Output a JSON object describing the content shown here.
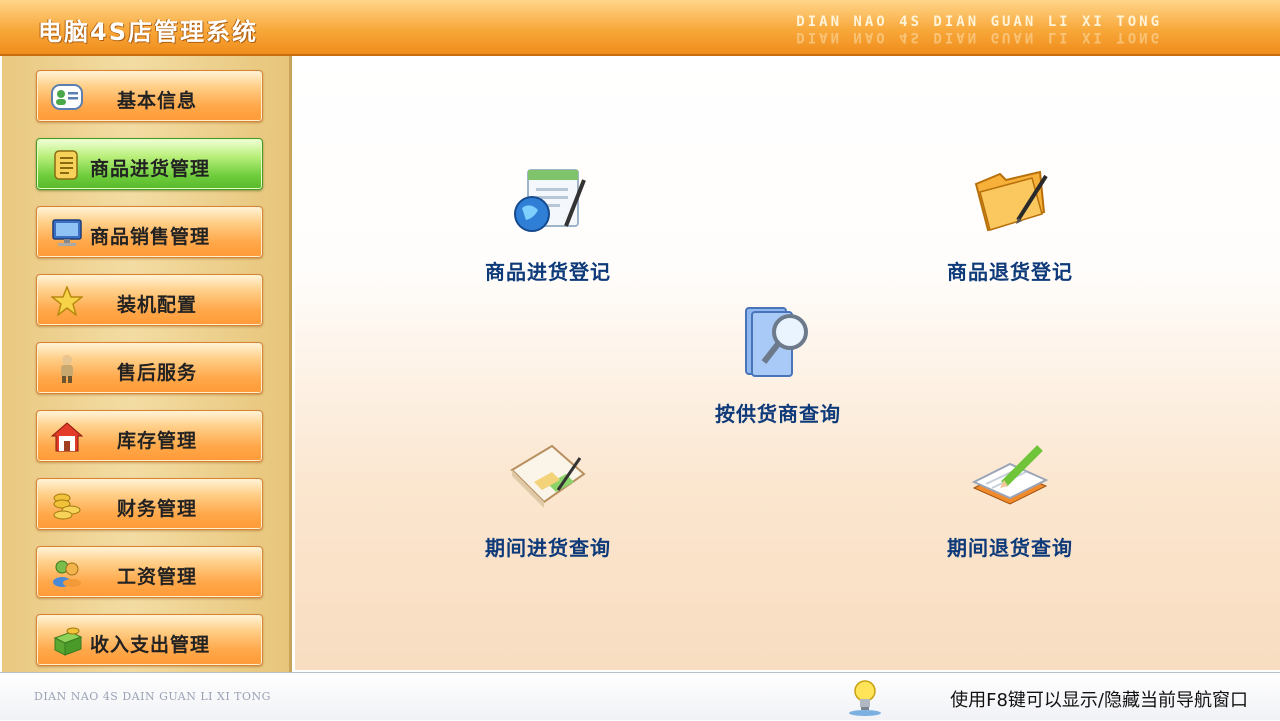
{
  "titlebar": {
    "title": "电脑4S店管理系统",
    "subtitle": "DIAN NAO 4S DIAN GUAN LI XI TONG"
  },
  "sidebar": {
    "items": [
      {
        "label": "基本信息",
        "icon": "contact-card-icon",
        "active": false
      },
      {
        "label": "商品进货管理",
        "icon": "document-list-icon",
        "active": true
      },
      {
        "label": "商品销售管理",
        "icon": "computer-monitor-icon",
        "active": false
      },
      {
        "label": "装机配置",
        "icon": "star-icon",
        "active": false
      },
      {
        "label": "售后服务",
        "icon": "person-icon",
        "active": false
      },
      {
        "label": "库存管理",
        "icon": "house-icon",
        "active": false
      },
      {
        "label": "财务管理",
        "icon": "coins-icon",
        "active": false
      },
      {
        "label": "工资管理",
        "icon": "users-icon",
        "active": false
      },
      {
        "label": "收入支出管理",
        "icon": "money-box-icon",
        "active": false
      }
    ]
  },
  "main": {
    "actions": [
      {
        "label": "商品进货登记",
        "icon": "globe-document-icon"
      },
      {
        "label": "商品退货登记",
        "icon": "folder-pen-icon"
      },
      {
        "label": "按供货商查询",
        "icon": "search-documents-icon"
      },
      {
        "label": "期间进货查询",
        "icon": "notebook-chart-icon"
      },
      {
        "label": "期间退货查询",
        "icon": "notepad-pencil-icon"
      }
    ]
  },
  "statusbar": {
    "left_text": "DIAN NAO 4S DAIN GUAN LI XI TONG",
    "hint": "使用F8键可以显示/隐藏当前导航窗口",
    "icon": "lightbulb-icon"
  },
  "colors": {
    "title_orange": "#f8a83a",
    "nav_orange": "#ffa84a",
    "nav_active_green": "#6ccc3a",
    "action_label_blue": "#0e3a7a"
  }
}
